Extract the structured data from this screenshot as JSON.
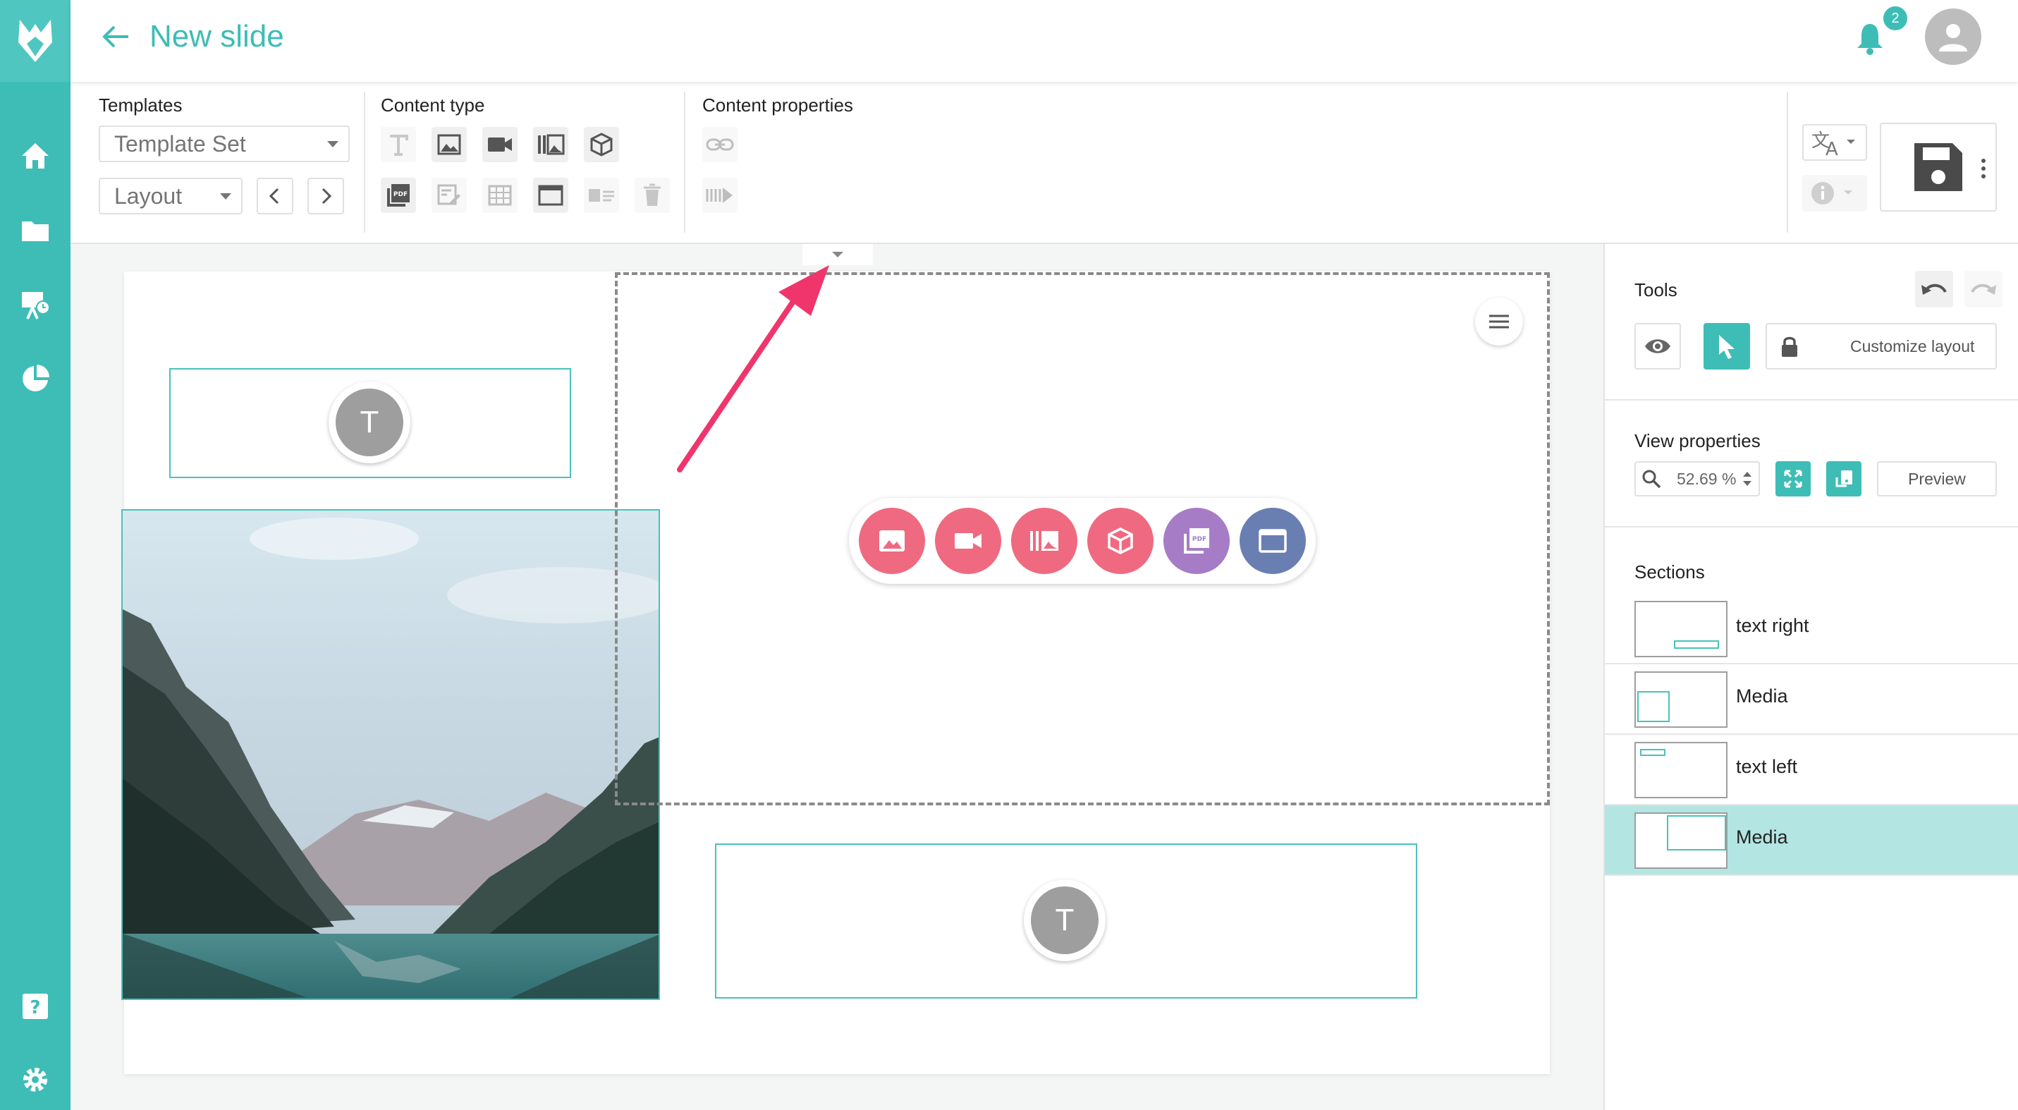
{
  "header": {
    "title": "New slide",
    "notification_count": "2"
  },
  "toolbar": {
    "templates_label": "Templates",
    "template_set": "Template Set",
    "layout": "Layout",
    "content_type_label": "Content type",
    "content_properties_label": "Content properties"
  },
  "canvas": {
    "text_placeholder": "T"
  },
  "tools": {
    "label": "Tools",
    "customize_layout": "Customize layout"
  },
  "view_properties": {
    "label": "View properties",
    "zoom": "52.69 %",
    "preview": "Preview"
  },
  "sections": {
    "label": "Sections",
    "items": [
      {
        "name": "text right"
      },
      {
        "name": "Media"
      },
      {
        "name": "text left"
      },
      {
        "name": "Media",
        "active": true
      }
    ]
  },
  "colors": {
    "accent": "#3dbdb6",
    "annotation_arrow": "#f0356c",
    "picker_red": "#ef6a80",
    "picker_purple": "#a67cc6",
    "picker_blue": "#6a7fb1"
  }
}
